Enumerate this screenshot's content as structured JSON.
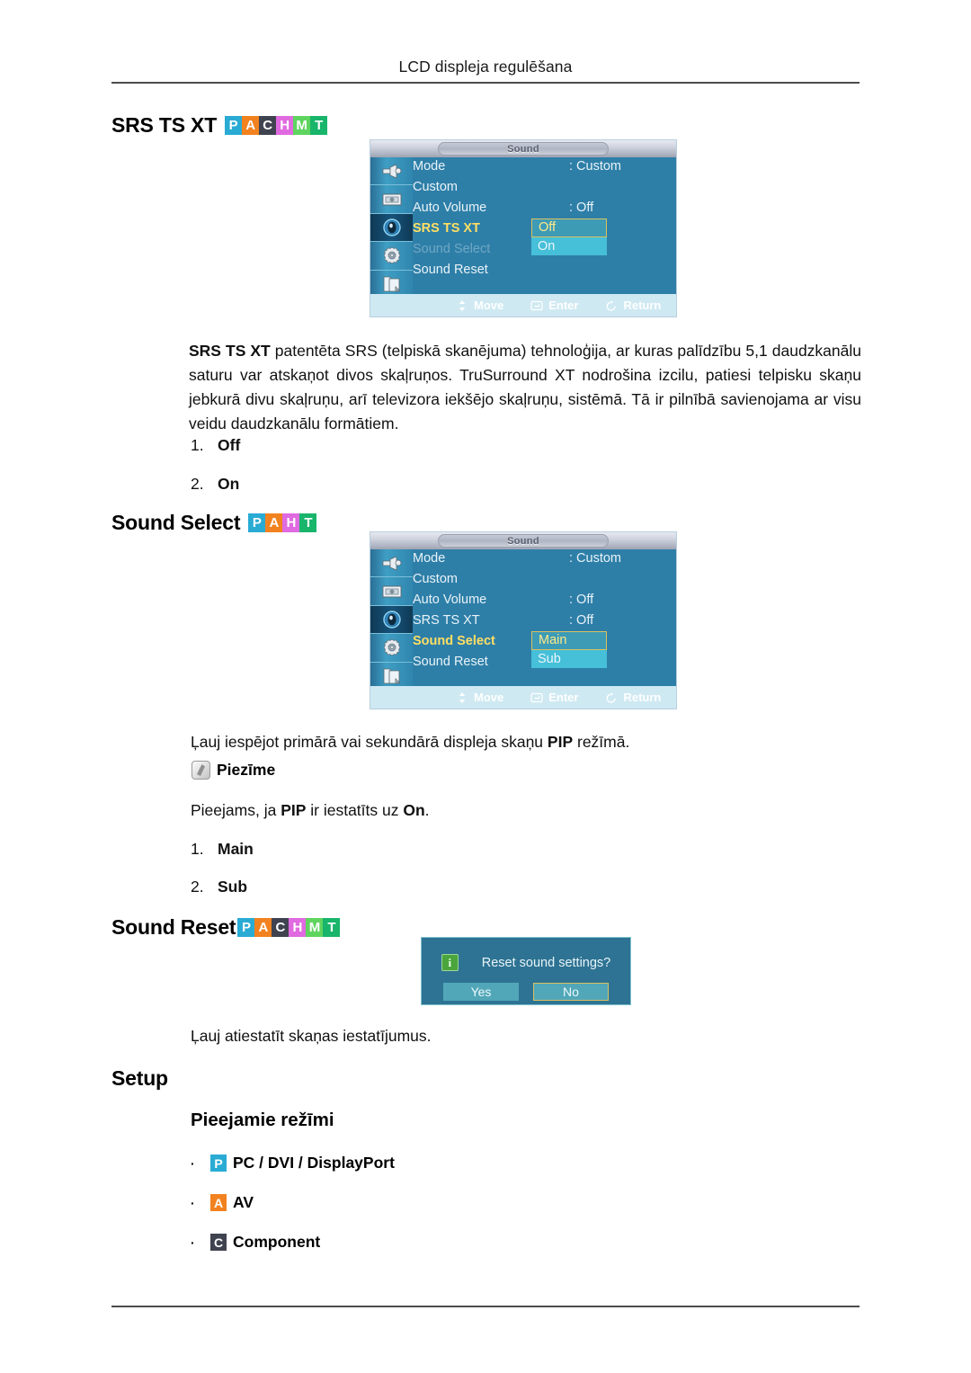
{
  "running_head": "LCD displeja regulēšana",
  "badge_colors": {
    "P": "#29abd4",
    "A": "#f2821f",
    "C": "#3f4350",
    "H": "#e06ae0",
    "M": "#5fd45f",
    "T": "#18b56b"
  },
  "sections": {
    "srs": {
      "heading": "SRS TS XT",
      "badges": [
        "P",
        "A",
        "C",
        "H",
        "M",
        "T"
      ],
      "paragraph_html": "<b>SRS TS XT</b> patentēta SRS (telpiskā skanējuma) tehnoloģija, ar kuras palīdzību 5,1 daudzkanālu saturu var atskaņot divos skaļruņos. TruSurround XT nodrošina izcilu, patiesi telpisku skaņu jebkurā divu skaļruņu, arī televizora iekšējo skaļruņu, sistēmā. Tā ir pilnībā savienojama ar visu veidu daudzkanālu formātiem.",
      "options": [
        {
          "num": "1.",
          "value": "Off"
        },
        {
          "num": "2.",
          "value": "On"
        }
      ],
      "osd": {
        "title": "Sound",
        "rows": [
          {
            "label": "Mode",
            "value": ": Custom",
            "state": "normal"
          },
          {
            "label": "Custom",
            "value": "",
            "state": "normal"
          },
          {
            "label": "Auto Volume",
            "value": ": Off",
            "state": "normal"
          },
          {
            "label": "SRS TS XT",
            "value": ":",
            "state": "selected"
          },
          {
            "label": "Sound Select",
            "value": "",
            "state": "dim"
          },
          {
            "label": "Sound Reset",
            "value": "",
            "state": "normal"
          }
        ],
        "dropdown": {
          "top_row_index": 3,
          "options": [
            {
              "label": "Off",
              "current": true
            },
            {
              "label": "On",
              "current": false
            }
          ]
        },
        "footer": [
          {
            "icon": "updown-arrow-icon",
            "label": "Move"
          },
          {
            "icon": "enter-key-icon",
            "label": "Enter"
          },
          {
            "icon": "return-arrow-icon",
            "label": "Return"
          }
        ],
        "sidebar_icons": [
          "input-source-icon",
          "picture-icon",
          "sound-icon",
          "setup-gear-icon",
          "multi-control-icon"
        ],
        "active_sidebar_index": 2
      }
    },
    "sound_select": {
      "heading": "Sound Select",
      "badges": [
        "P",
        "A",
        "H",
        "T"
      ],
      "description_html": "Ļauj iespējot primārā vai sekundārā displeja skaņu <b>PIP</b> režīmā.",
      "note_label": "Piezīme",
      "note_text_html": "Pieejams, ja <b>PIP</b> ir iestatīts uz <b>On</b>.",
      "options": [
        {
          "num": "1.",
          "value": "Main"
        },
        {
          "num": "2.",
          "value": "Sub"
        }
      ],
      "osd": {
        "title": "Sound",
        "rows": [
          {
            "label": "Mode",
            "value": ": Custom",
            "state": "normal"
          },
          {
            "label": "Custom",
            "value": "",
            "state": "normal"
          },
          {
            "label": "Auto Volume",
            "value": ": Off",
            "state": "normal"
          },
          {
            "label": "SRS TS XT",
            "value": ": Off",
            "state": "normal"
          },
          {
            "label": "Sound Select",
            "value": ":",
            "state": "selected"
          },
          {
            "label": "Sound Reset",
            "value": "",
            "state": "normal"
          }
        ],
        "dropdown": {
          "top_row_index": 4,
          "options": [
            {
              "label": "Main",
              "current": true
            },
            {
              "label": "Sub",
              "current": false
            }
          ]
        },
        "footer": [
          {
            "icon": "updown-arrow-icon",
            "label": "Move"
          },
          {
            "icon": "enter-key-icon",
            "label": "Enter"
          },
          {
            "icon": "return-arrow-icon",
            "label": "Return"
          }
        ],
        "sidebar_icons": [
          "input-source-icon",
          "picture-icon",
          "sound-icon",
          "setup-gear-icon",
          "multi-control-icon"
        ],
        "active_sidebar_index": 2
      }
    },
    "sound_reset": {
      "heading": "Sound Reset",
      "badges": [
        "P",
        "A",
        "C",
        "H",
        "M",
        "T"
      ],
      "description": "Ļauj atiestatīt skaņas iestatījumus.",
      "dialog": {
        "message": "Reset sound settings?",
        "info_icon": "info-icon",
        "buttons": [
          {
            "label": "Yes",
            "current": false
          },
          {
            "label": "No",
            "current": true
          }
        ]
      }
    },
    "setup": {
      "heading": "Setup",
      "subheading": "Pieejamie režīmi",
      "modes": [
        {
          "badge": "P",
          "label": "PC / DVI / DisplayPort"
        },
        {
          "badge": "A",
          "label": "AV"
        },
        {
          "badge": "C",
          "label": "Component"
        }
      ]
    }
  }
}
